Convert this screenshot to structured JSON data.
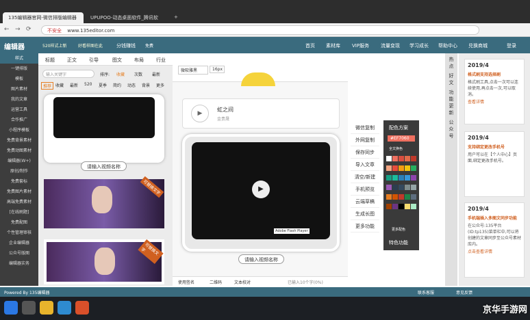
{
  "browser": {
    "tabs": [
      {
        "label": "135编辑器官网-微信排版编辑器"
      },
      {
        "label": "UPUPOO-动态桌面软件_腾讯软"
      }
    ],
    "url_warning": "不安全",
    "url": "www.135editor.com"
  },
  "app": {
    "logo": "编辑器",
    "promo1": "520样式上新",
    "promo2": "好看样图在此",
    "share": "分钱赚钱",
    "vip_free": "免费",
    "nav": [
      "首页",
      "素材库",
      "VIP服务",
      "流量变现",
      "学习成长",
      "帮助中心",
      "兑换商城"
    ],
    "login": "登录"
  },
  "left_nav": {
    "items": [
      "样式",
      "一键排版",
      "模板",
      "图片素材",
      "我的文章",
      "运营工具",
      "合作推广",
      "小程序模板",
      "免费背景素材",
      "免费动图素材",
      "编辑器(W+)",
      "原创/制作",
      "免费套标",
      "免费图片素材",
      "高端免费素材",
      "[在线刷题]",
      "免费配图",
      "个性管理审核",
      "企业编辑器",
      "公众号版图",
      "编辑器实务"
    ]
  },
  "material": {
    "tabs": [
      "标题",
      "正文",
      "引导",
      "图文",
      "布局",
      "行业"
    ],
    "search_placeholder": "输入关键字",
    "sort_label": "排序:",
    "sort_opts": [
      "收藏",
      "次数",
      "最新"
    ],
    "filters": [
      "推荐",
      "收藏",
      "最新",
      "520",
      "夏季",
      "简约",
      "动态",
      "背景",
      "更多"
    ],
    "video_caption": "请输入视频名称",
    "badge": "可替换文字"
  },
  "editor": {
    "font": "微软雅黑",
    "size": "16px",
    "card_title": "虹之间",
    "card_sub": "金贵晟",
    "flash": "Adobe Flash Player",
    "video_caption": "请输入视频名称",
    "bottom": [
      "使用签名",
      "二维码",
      "文本校对"
    ],
    "count": "已输入10个字(0%)"
  },
  "tools": [
    "微信复制",
    "外网复制",
    "保存同步",
    "导入文章",
    "清空/新建",
    "手机预览",
    "云端草稿",
    "生成长图",
    "更多功能"
  ],
  "palette": {
    "title": "配色方案",
    "hex": "#EF7060",
    "full": "全文换色",
    "more": "更多配色",
    "feature": "特色功能",
    "colors": [
      "#ffffff",
      "#ef7060",
      "#d94e3f",
      "#e26b4a",
      "#c0392b",
      "#f4a582",
      "#e74c3c",
      "#f39c12",
      "#f1c40f",
      "#27ae60",
      "#16a085",
      "#1abc9c",
      "#2980b9",
      "#3498db",
      "#8e44ad",
      "#9b59b6",
      "#2c3e50",
      "#34495e",
      "#7f8c8d",
      "#95a5a6",
      "#e67e22",
      "#d35400",
      "#c0392b",
      "#1e8449",
      "#5d6d7e",
      "#a04000",
      "#6c3483",
      "#000000",
      "#f7dc6f",
      "#abebc6"
    ]
  },
  "right_tabs": [
    "热点",
    "好文",
    "功能更新",
    "公众号"
  ],
  "news": [
    {
      "date": "2019/4",
      "title": "格式刷支持选择刷",
      "text": "格式刷工具,点击一次可以连续使用,再点击一次,可以取消。",
      "link": "查看详情"
    },
    {
      "date": "2019/4",
      "title": "支持绑定更改手机号",
      "text": "用户可以在【个人中心】页面,绑定更改手机号。",
      "link": ""
    },
    {
      "date": "2019/4",
      "title": "手机端插入多图文同步功能",
      "text": "在公众号:135平台(ID:tp135)菜单栏中,可以将创建的文章同步至公众号素材库内。",
      "link": "点击查看详情"
    }
  ],
  "status": {
    "text": "Powered By 135编辑器",
    "contact": "联系客服",
    "feedback": "意见反馈"
  },
  "watermark": "京华手游网"
}
